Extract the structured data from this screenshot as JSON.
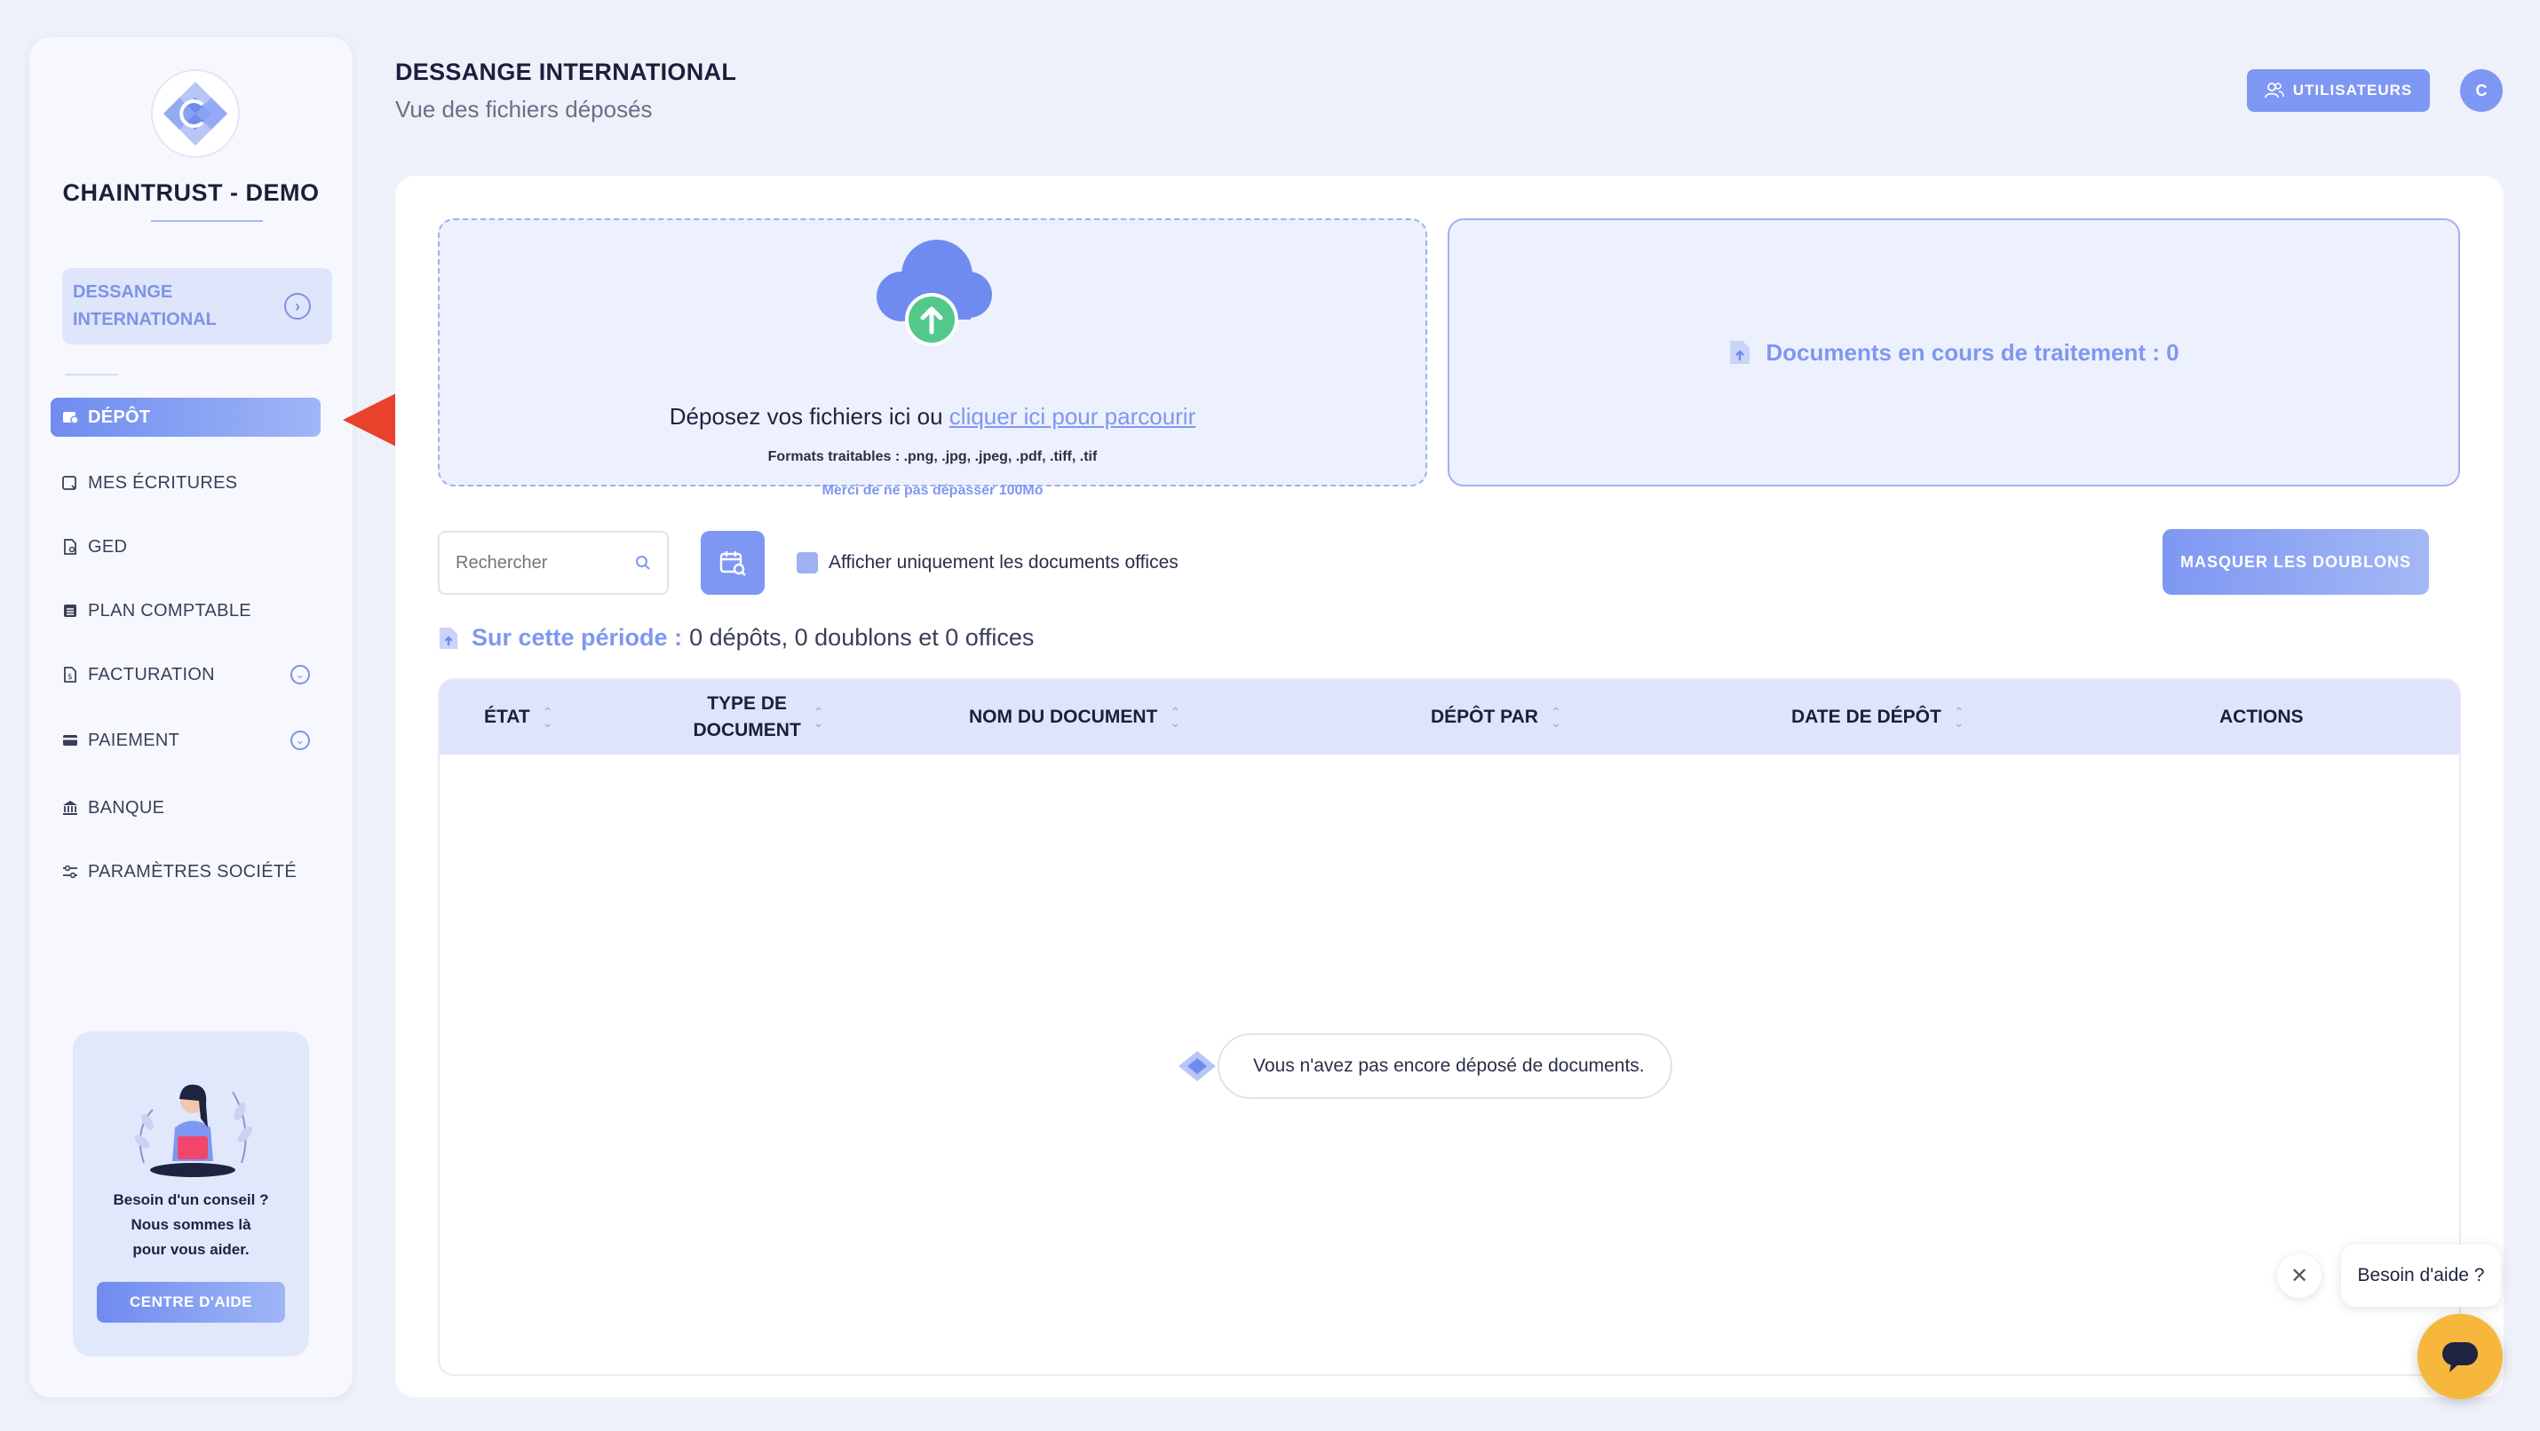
{
  "sidebar": {
    "brand": "CHAINTRUST - DEMO",
    "company": "DESSANGE INTERNATIONAL",
    "items": [
      {
        "label": "DÉPÔT",
        "icon": "deposit-icon",
        "active": true
      },
      {
        "label": "MES ÉCRITURES",
        "icon": "entries-icon"
      },
      {
        "label": "GED",
        "icon": "document-icon"
      },
      {
        "label": "PLAN COMPTABLE",
        "icon": "ledger-icon"
      },
      {
        "label": "FACTURATION",
        "icon": "invoice-icon",
        "expandable": true
      },
      {
        "label": "PAIEMENT",
        "icon": "card-icon",
        "expandable": true
      },
      {
        "label": "BANQUE",
        "icon": "bank-icon"
      },
      {
        "label": "PARAMÈTRES SOCIÉTÉ",
        "icon": "settings-sliders-icon"
      }
    ],
    "help": {
      "line1": "Besoin d'un conseil ?",
      "line2": "Nous sommes là",
      "line3": "pour vous aider.",
      "button": "CENTRE D'AIDE"
    }
  },
  "header": {
    "title": "DESSANGE INTERNATIONAL",
    "subtitle": "Vue des fichiers déposés",
    "users_button": "UTILISATEURS",
    "avatar_initial": "C"
  },
  "upload": {
    "text": "Déposez vos fichiers ici ou",
    "link": "cliquer ici pour parcourir",
    "formats": "Formats traitables : .png, .jpg, .jpeg, .pdf, .tiff, .tif",
    "limit": "Merci de ne pas dépasser 100Mo"
  },
  "processing": "Documents en cours de traitement : 0",
  "toolbar": {
    "search_placeholder": "Rechercher",
    "filter_label": "Afficher uniquement les documents offices",
    "duplicates_button": "MASQUER LES DOUBLONS"
  },
  "period": {
    "label": "Sur cette période :",
    "summary": "0 dépôts, 0 doublons et 0 offices"
  },
  "table": {
    "columns": [
      "ÉTAT",
      "TYPE DE DOCUMENT",
      "NOM DU DOCUMENT",
      "DÉPÔT PAR",
      "DATE DE DÉPÔT",
      "ACTIONS"
    ],
    "type_col_line1": "TYPE DE",
    "type_col_line2": "DOCUMENT",
    "empty_message": "Vous n'avez pas encore déposé de documents."
  },
  "chat": {
    "bubble": "Besoin d'aide ?"
  },
  "colors": {
    "accent": "#7e97f2",
    "arrow": "#e8412c",
    "chat": "#f6b73c"
  }
}
